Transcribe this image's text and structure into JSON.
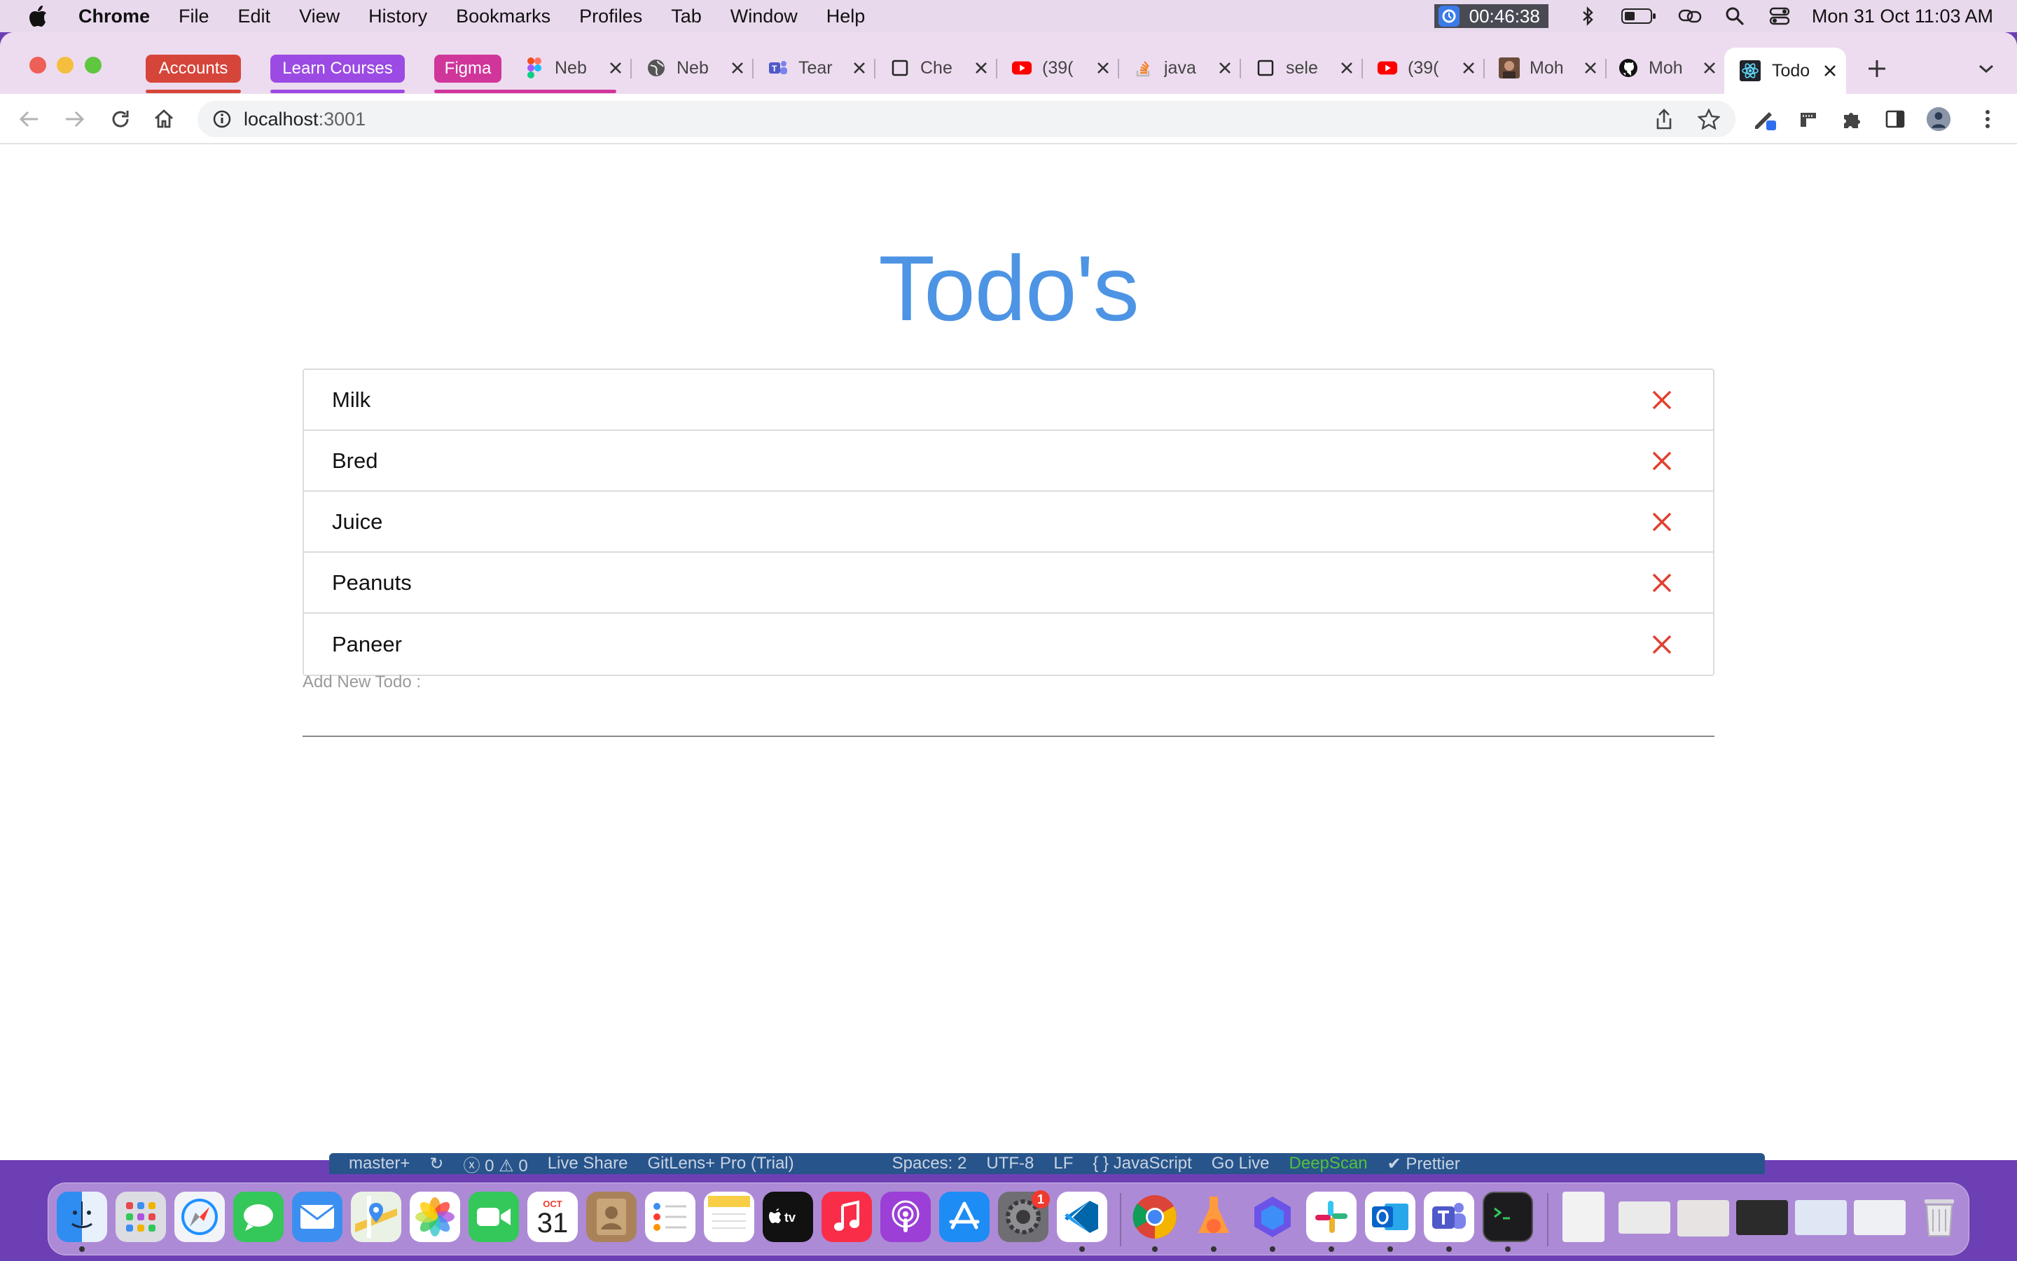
{
  "menubar": {
    "app_name": "Chrome",
    "menus": [
      "File",
      "Edit",
      "View",
      "History",
      "Bookmarks",
      "Profiles",
      "Tab",
      "Window",
      "Help"
    ],
    "timer": "00:46:38",
    "datetime": "Mon 31 Oct  11:03 AM"
  },
  "tabstrip": {
    "groups": [
      {
        "label": "Accounts",
        "color": "#d6453a"
      },
      {
        "label": "Learn Courses",
        "color": "#9b4be3"
      },
      {
        "label": "Figma",
        "color": "#d0369a"
      }
    ],
    "tabs": [
      {
        "title": "Neb",
        "icon": "figma-icon"
      },
      {
        "title": "Neb",
        "icon": "globe-icon"
      },
      {
        "title": "Tear",
        "icon": "teams-icon"
      },
      {
        "title": "Che",
        "icon": "checkbox-icon"
      },
      {
        "title": "(39(",
        "icon": "youtube-icon"
      },
      {
        "title": "java",
        "icon": "stackoverflow-icon"
      },
      {
        "title": "sele",
        "icon": "checkbox-icon"
      },
      {
        "title": "(39(",
        "icon": "youtube-icon"
      },
      {
        "title": "Moh",
        "icon": "avatar-icon"
      },
      {
        "title": "Moh",
        "icon": "github-icon"
      }
    ],
    "active_tab": {
      "title": "Todo",
      "icon": "react-icon"
    }
  },
  "address_bar": {
    "host": "localhost",
    "port": ":3001"
  },
  "app": {
    "title": "Todo's",
    "todos": [
      "Milk",
      "Bred",
      "Juice",
      "Peanuts",
      "Paneer"
    ],
    "add_label": "Add New Todo :",
    "input_value": "",
    "accent_color": "#4d94e4",
    "delete_color": "#e0402f"
  },
  "vscode_status": {
    "branch": "master+",
    "problems": "ⓧ 0 ⚠ 0",
    "live_share": "Live Share",
    "gitlens": "GitLens+ Pro (Trial)",
    "spaces": "Spaces: 2",
    "encoding": "UTF-8",
    "eol": "LF",
    "language": "{ } JavaScript",
    "go_live": "Go Live",
    "deepscan": "DeepScan",
    "prettier": "✔ Prettier"
  },
  "dock": {
    "calendar_month": "OCT",
    "calendar_day": "31",
    "settings_badge": "1",
    "apps": [
      "finder",
      "launchpad",
      "safari",
      "messages",
      "mail",
      "maps",
      "photos",
      "facetime",
      "calendar",
      "contacts",
      "reminders",
      "notes",
      "tv",
      "music",
      "podcasts",
      "app-store",
      "system-preferences",
      "vscode",
      "chrome",
      "postman",
      "nebula",
      "slack",
      "outlook",
      "teams",
      "terminal"
    ]
  }
}
